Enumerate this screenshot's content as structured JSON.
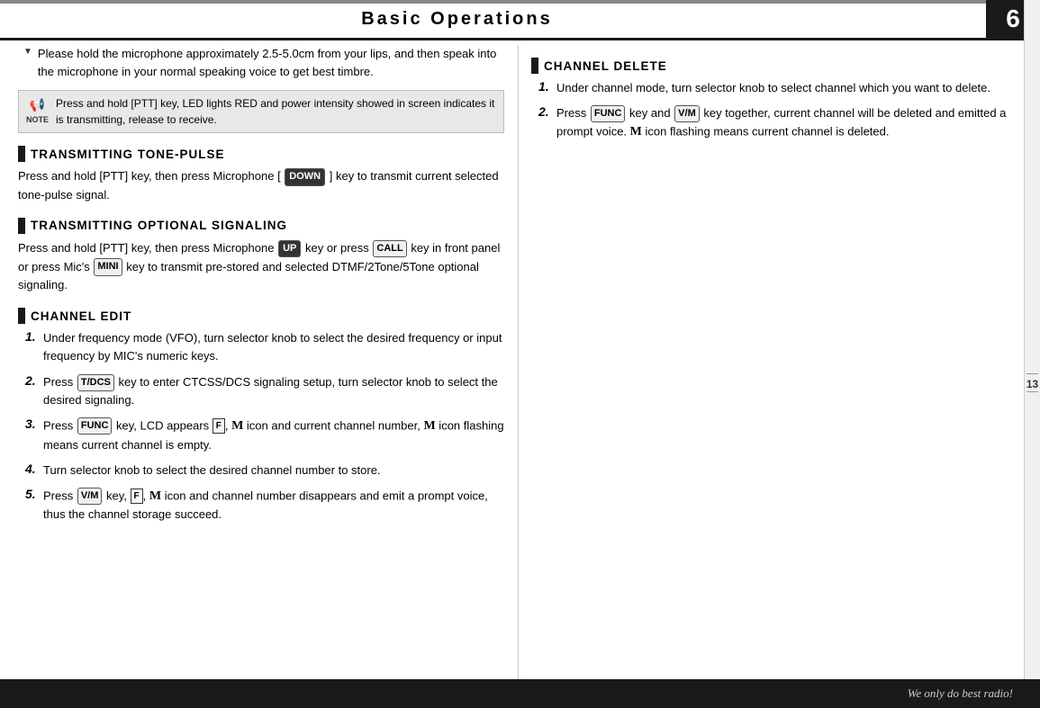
{
  "header": {
    "title": "Basic  Operations",
    "number": "6",
    "top_line_color": "#888",
    "header_bg": "#1a1a1a"
  },
  "footer": {
    "text": "We only do best radio!"
  },
  "sidebar": {
    "page_number": "13"
  },
  "left_col": {
    "intro_bullet": {
      "text": "Please hold the microphone approximately 2.5-5.0cm from your lips, and then speak into the microphone in your normal speaking voice to get best timbre."
    },
    "note": {
      "icon": "🔊",
      "label": "NOTE",
      "text": "Press and hold [PTT] key, LED lights RED and power intensity showed in screen indicates it is transmitting, release to receive."
    },
    "section1": {
      "title": "TRANSMITTING TONE-PULSE",
      "body": "Press and hold [PTT] key, then press Microphone [",
      "key_down": "DOWN",
      "body2": " ] key to transmit current selected tone-pulse signal."
    },
    "section2": {
      "title": "TRANSMITTING OPTIONAL SIGNALING",
      "body1": "Press and hold [PTT] key, then press Microphone ",
      "key_up": "UP",
      "body2": " key or press ",
      "key_call": "CALL",
      "body3": " key in front panel or press Mic's ",
      "key_mini": "MINI",
      "body4": " key to transmit pre-stored and selected DTMF/2Tone/5Tone optional signaling."
    },
    "section3": {
      "title": "CHANNEL EDIT",
      "items": [
        {
          "num": "1.",
          "text": "Under frequency mode (VFO), turn selector knob to select the desired frequency or input frequency by MIC's numeric keys."
        },
        {
          "num": "2.",
          "text": "Press  key to enter CTCSS/DCS signaling setup, turn selector knob to select the desired signaling.",
          "key": "T/DCS"
        },
        {
          "num": "3.",
          "text": "Press  key, LCD appears  ,  icon and current channel number,  icon flashing means current channel is empty.",
          "key_func": "FUNC",
          "icon_f": "F",
          "icon_m": "M"
        },
        {
          "num": "4.",
          "text": "Turn selector knob to select the desired channel number to store."
        },
        {
          "num": "5.",
          "text": "Press  key,  ,  icon and channel number disappears and emit a prompt voice, thus the channel storage succeed.",
          "key_vm": "V/M",
          "icon_f": "F",
          "icon_m": "M"
        }
      ]
    }
  },
  "right_col": {
    "section1": {
      "title": "CHANNEL DELETE",
      "items": [
        {
          "num": "1.",
          "text": "Under channel mode, turn selector knob to select channel which you want to delete."
        },
        {
          "num": "2.",
          "text": "Press  key and  key together, current channel will be deleted and emitted a prompt voice.  icon flashing means current channel is deleted.",
          "key_func": "FUNC",
          "key_vm": "V/M",
          "icon_m": "M"
        }
      ]
    }
  }
}
